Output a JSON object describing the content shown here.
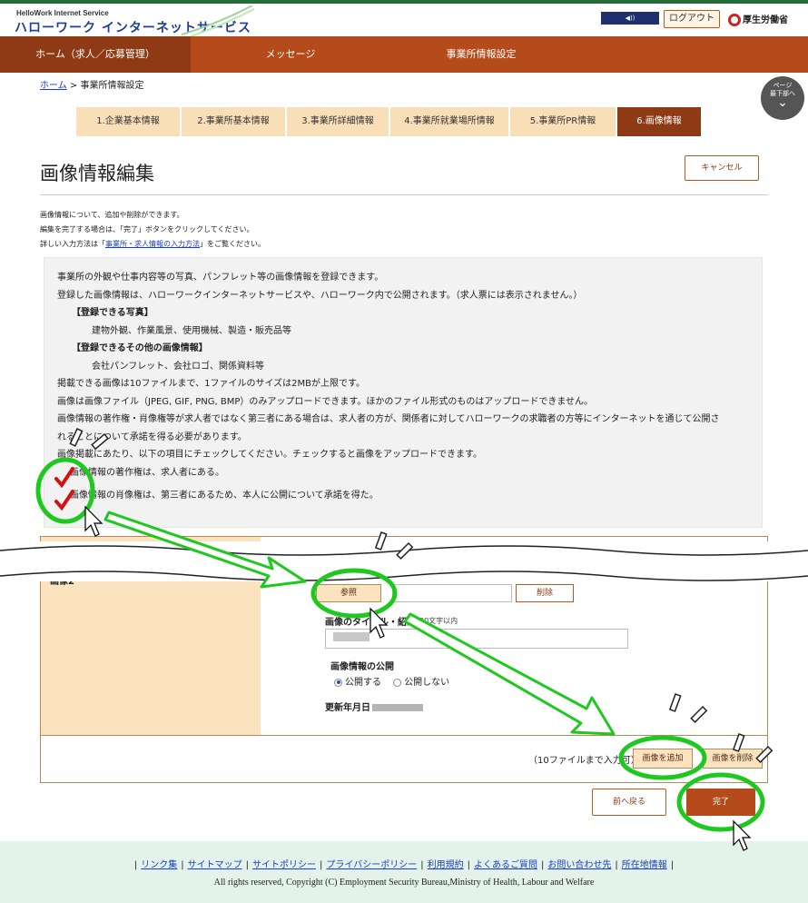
{
  "header": {
    "logo_en": "HelloWork Internet Service",
    "logo_jp": "ハローワーク インターネットサービス",
    "logout_label": "ログアウト",
    "ministry_label": "厚生労働省"
  },
  "nav": {
    "items": [
      "ホーム（求人／応募管理）",
      "メッセージ",
      "事業所情報設定"
    ]
  },
  "breadcrumb": {
    "home": "ホーム",
    "current": " > 事業所情報設定"
  },
  "page_top": {
    "label1": "ページ",
    "label2": "最下部へ"
  },
  "steps": [
    "1.企業基本情報",
    "2.事業所基本情報",
    "3.事業所詳細情報",
    "4.事業所就業場所情報",
    "5.事業所PR情報",
    "6.画像情報"
  ],
  "page": {
    "title": "画像情報編集",
    "cancel_label": "キャンセル"
  },
  "intro": {
    "line1": "画像情報について、追加や削除ができます。",
    "line2": "編集を完了する場合は、「完了」ボタンをクリックしてください。",
    "line3_prefix": "詳しい入力方法は「",
    "line3_link": "事業所・求人情報の入力方法",
    "line3_suffix": "」をご覧ください。"
  },
  "info": {
    "l1": "事業所の外観や仕事内容等の写真、パンフレット等の画像情報を登録できます。",
    "l2": "登録した画像情報は、ハローワークインターネットサービスや、ハローワーク内で公開されます。（求人票には表示されません。）",
    "l3": "【登録できる写真】",
    "l4": "建物外観、作業風景、使用機械、製造・販売品等",
    "l5": "【登録できるその他の画像情報】",
    "l6": "会社パンフレット、会社ロゴ、関係資料等",
    "l7": "掲載できる画像は10ファイルまで、1ファイルのサイズは2MBが上限です。",
    "l8": "画像は画像ファイル（JPEG, GIF, PNG, BMP）のみアップロードできます。ほかのファイル形式のものはアップロードできません。",
    "l9": "画像情報の著作権・肖像権等が求人者ではなく第三者にある場合は、求人者の方が、関係者に対してハローワークの求職者の方等にインターネットを通じて公開さ",
    "l10": "れることについて承諾を得る必要があります。",
    "l11": "画像掲載にあたり、以下の項目にチェックしてください。チェックすると画像をアップロードできます。",
    "check1": "画像情報の著作権は、求人者にある。",
    "check2": "画像情報の肖像権は、第三者にあるため、本人に公開について承諾を得た。"
  },
  "form": {
    "row_label": "画像2",
    "browse_label": "参照",
    "delete_label": "削除",
    "caption_label": "画像のタイトル・紹介",
    "caption_hint": "全角30文字以内",
    "public_label": "画像情報の公開",
    "public_yes": "公開する",
    "public_no": "公開しない",
    "updated_label": "更新年月日"
  },
  "bottom": {
    "limit_note": "（10ファイルまで入力可）",
    "add_label": "画像を追加",
    "remove_label": "画像を削除",
    "back_label": "前へ戻る",
    "done_label": "完了"
  },
  "footer": {
    "links": [
      "リンク集",
      "サイトマップ",
      "サイトポリシー",
      "プライバシーポリシー",
      "利用規約",
      "よくあるご質問",
      "お問い合わせ先",
      "所在地情報"
    ],
    "copyright": "All rights reserved, Copyright (C) Employment Security Bureau,Ministry of Health, Labour and Welfare"
  },
  "colors": {
    "brand_green": "#246b3a",
    "nav_orange": "#b54b1b",
    "highlight_green": "#1fc81f",
    "check_red": "#d81010"
  }
}
